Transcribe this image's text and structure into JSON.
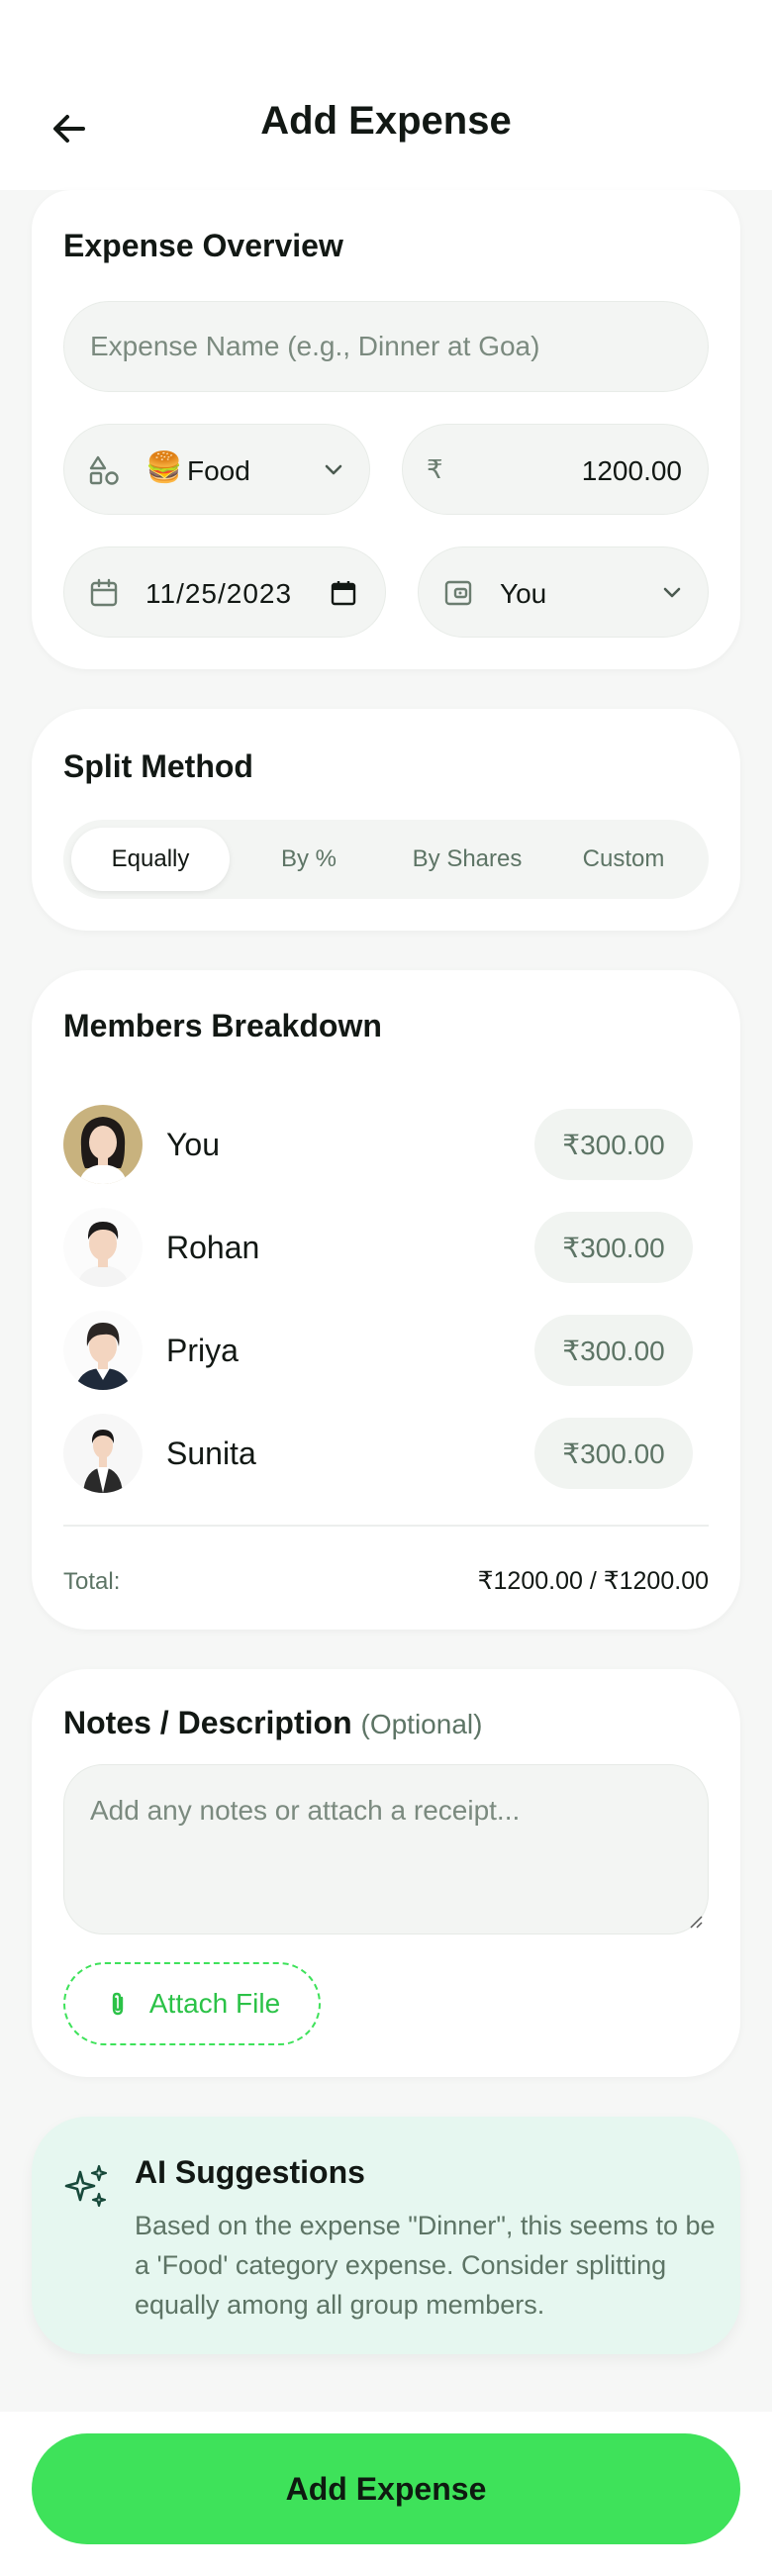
{
  "header": {
    "title": "Add Expense"
  },
  "overview": {
    "title": "Expense Overview",
    "name_placeholder": "Expense Name (e.g., Dinner at Goa)",
    "category": {
      "emoji": "🍔",
      "label": "Food"
    },
    "currency_symbol": "₹",
    "amount": "1200.00",
    "date": "11/25/2023",
    "payer": "You"
  },
  "split": {
    "title": "Split Method",
    "options": [
      "Equally",
      "By %",
      "By Shares",
      "Custom"
    ],
    "selected": "Equally"
  },
  "members": {
    "title": "Members Breakdown",
    "list": [
      {
        "name": "You",
        "amount": "₹300.00"
      },
      {
        "name": "Rohan",
        "amount": "₹300.00"
      },
      {
        "name": "Priya",
        "amount": "₹300.00"
      },
      {
        "name": "Sunita",
        "amount": "₹300.00"
      }
    ],
    "total_label": "Total:",
    "total_value": "₹1200.00 / ₹1200.00"
  },
  "notes": {
    "title": "Notes / Description",
    "optional": "(Optional)",
    "placeholder": "Add any notes or attach a receipt...",
    "attach_label": "Attach File"
  },
  "ai": {
    "title": "AI Suggestions",
    "text": "Based on the expense \"Dinner\", this seems to be a 'Food' category expense. Consider splitting equally among all group members."
  },
  "footer": {
    "button_label": "Add Expense"
  },
  "colors": {
    "accent": "#3ee25a",
    "accent_dark": "#2bc247",
    "muted_green": "#5d7465",
    "ai_bg": "#e6f7f0",
    "page_bg": "#f6f7f6"
  }
}
